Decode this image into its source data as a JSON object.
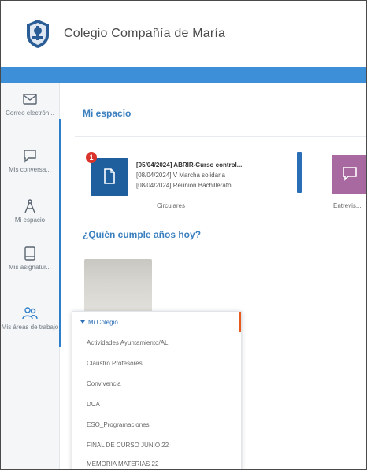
{
  "header": {
    "title": "Colegio Compañía de María"
  },
  "sidebar": {
    "items": [
      {
        "label": "Correo electrón...",
        "icon": "mail-icon"
      },
      {
        "label": "Mis conversa...",
        "icon": "chat-icon"
      },
      {
        "label": "Mi espacio",
        "icon": "compass-icon"
      },
      {
        "label": "Mis asignatur...",
        "icon": "tablet-icon"
      },
      {
        "label": "Mis áreas de trabajo",
        "icon": "users-icon"
      }
    ]
  },
  "main": {
    "section_title": "Mi espacio",
    "card": {
      "badge": "1",
      "lines": [
        "[05/04/2024] ABRIR-Curso control...",
        "[08/04/2024] V Marcha solidaria",
        "[08/04/2024] Reunión Bachillerato..."
      ],
      "caption": "Circulares"
    },
    "card2": {
      "caption": "Entrevis..."
    },
    "birthday_title": "¿Quién cumple años hoy?"
  },
  "dropdown": {
    "root": "Mi Colegio",
    "items": [
      "Actividades Ayuntamiento/AL",
      "Claustro Profesores",
      "Convivencia",
      "DUA",
      "ESO_Programaciones",
      "FINAL DE CURSO JUNIO 22",
      "MEMORIA MATERIAS 22"
    ]
  },
  "colors": {
    "topbar": "#3d8fd8",
    "accent_blue": "#2f7ec9",
    "card_icon": "#1f5f9e",
    "badge": "#d9332b",
    "card2": "#a868a0",
    "dropdown_accent": "#e85a1b"
  }
}
